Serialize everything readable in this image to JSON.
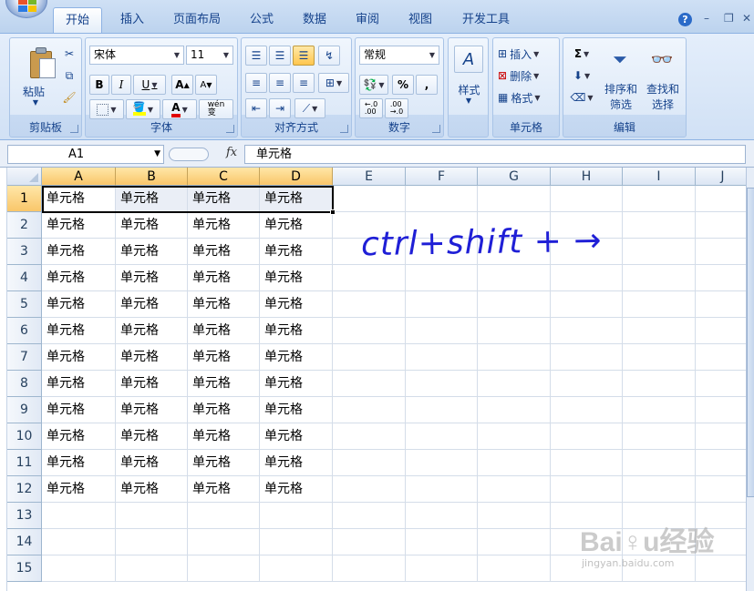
{
  "ribbon": {
    "tabs": [
      {
        "label": "开始",
        "active": true
      },
      {
        "label": "插入"
      },
      {
        "label": "页面布局"
      },
      {
        "label": "公式"
      },
      {
        "label": "数据"
      },
      {
        "label": "审阅"
      },
      {
        "label": "视图"
      },
      {
        "label": "开发工具"
      }
    ],
    "groups": {
      "clipboard": {
        "label": "剪贴板",
        "paste": "粘贴"
      },
      "font": {
        "label": "字体",
        "font_name": "宋体",
        "font_size": "11",
        "bold": "B",
        "italic": "I",
        "underline": "U",
        "grow": "A",
        "shrink": "A",
        "font_color": "A",
        "phonetic": "wén\n变"
      },
      "alignment": {
        "label": "对齐方式"
      },
      "number": {
        "label": "数字",
        "format": "常规",
        "percent": "%",
        "comma": ",",
        "inc_decimal": "←.0\n.00",
        "dec_decimal": ".00\n→.0"
      },
      "styles": {
        "label": "样式"
      },
      "cells": {
        "label": "单元格",
        "insert": "插入",
        "delete": "删除",
        "format": "格式"
      },
      "editing": {
        "label": "编辑",
        "sigma": "Σ",
        "sort": "排序和\n筛选",
        "find": "查找和\n选择"
      }
    }
  },
  "formula_bar": {
    "name_box": "A1",
    "fx": "fx",
    "content": "单元格"
  },
  "sheet": {
    "columns": [
      "A",
      "B",
      "C",
      "D",
      "E",
      "F",
      "G",
      "H",
      "I",
      "J"
    ],
    "rows": [
      "1",
      "2",
      "3",
      "4",
      "5",
      "6",
      "7",
      "8",
      "9",
      "10",
      "11",
      "12",
      "13",
      "14",
      "15"
    ],
    "cell_text": "单元格"
  },
  "annotation": {
    "text": "ctrl+shift + →"
  },
  "watermark": {
    "main": "Bai♀u经验",
    "sub": "jingyan.baidu.com"
  },
  "colors": {
    "accent": "#15428b",
    "selection": "#f9c66a",
    "ink": "#1f1fd6"
  }
}
